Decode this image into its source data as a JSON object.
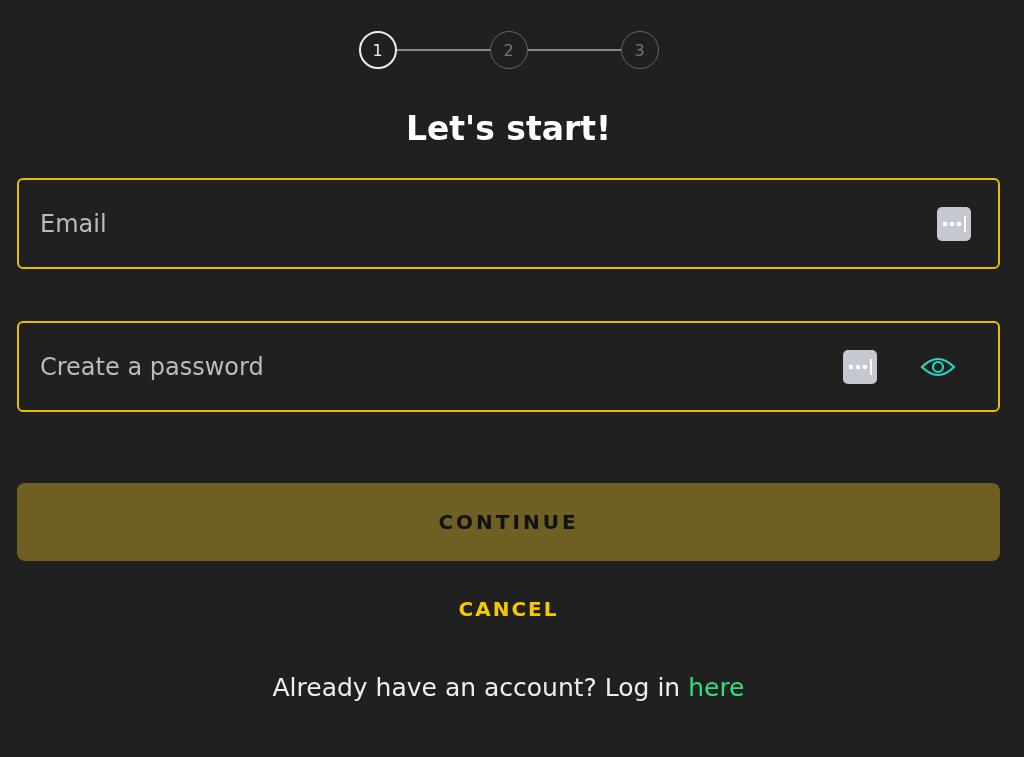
{
  "stepper": [
    {
      "label": "1",
      "selected": true
    },
    {
      "label": "2",
      "selected": false
    },
    {
      "label": "3",
      "selected": false
    }
  ],
  "title": "Let's start!",
  "fields": [
    {
      "placeholder": "Email",
      "kind": "text"
    },
    {
      "placeholder": "Create a password",
      "kind": "password"
    }
  ],
  "continue_button": {
    "label": "CONTINUE",
    "disabled": true
  },
  "cancel_link": "CANCEL",
  "footer": {
    "text": "Already have an account? Log in",
    "link": "here"
  }
}
